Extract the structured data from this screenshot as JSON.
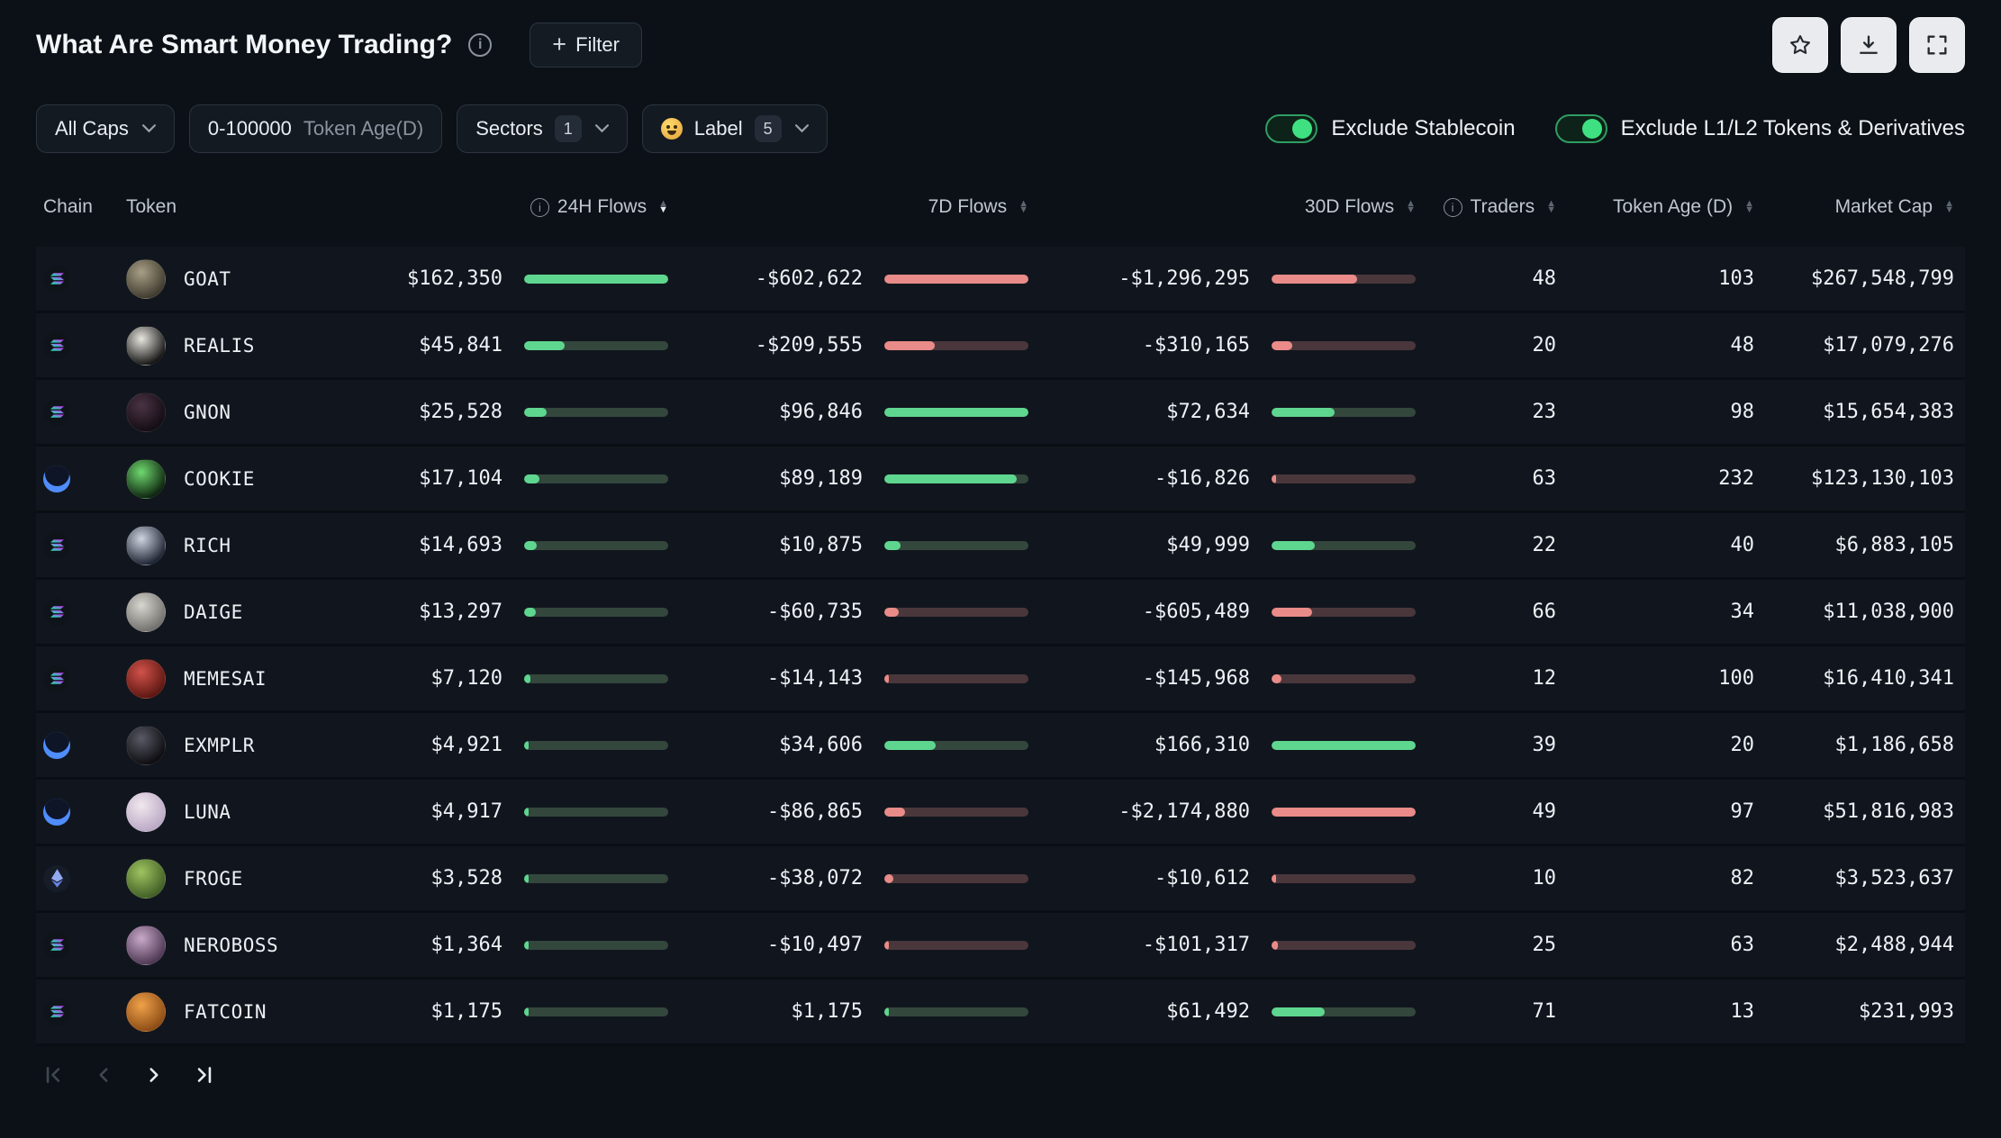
{
  "header": {
    "title": "What Are Smart Money Trading?",
    "filter_button_label": "Filter",
    "actions": [
      {
        "icon": "star"
      },
      {
        "icon": "download"
      },
      {
        "icon": "fullscreen"
      }
    ]
  },
  "filters": {
    "market_cap_dropdown": {
      "label": "All Caps"
    },
    "token_age_filter": {
      "value": "0-100000",
      "label": "Token Age(D)"
    },
    "sectors_dropdown": {
      "label": "Sectors",
      "count": "1"
    },
    "label_dropdown": {
      "label": "Label",
      "count": "5",
      "icon": "smart-money-face"
    },
    "exclude_stablecoin": {
      "label": "Exclude Stablecoin",
      "enabled": true
    },
    "exclude_l1l2": {
      "label": "Exclude L1/L2 Tokens & Derivatives",
      "enabled": true
    }
  },
  "table": {
    "columns": [
      {
        "label": "Chain"
      },
      {
        "label": "Token"
      },
      {
        "label": "24H Flows",
        "info": true,
        "sortable": true
      },
      {
        "label": "7D Flows",
        "sortable": true
      },
      {
        "label": "30D Flows",
        "sortable": true
      },
      {
        "label": "Traders",
        "info": true,
        "sortable": true
      },
      {
        "label": "Token Age (D)",
        "sortable": true
      },
      {
        "label": "Market Cap",
        "sortable": true
      }
    ],
    "sort": {
      "column": "24H Flows",
      "direction": "desc"
    },
    "rows": [
      {
        "chain": "solana",
        "token": "GOAT",
        "avatar_colors": [
          "#a89f86",
          "#3c382c"
        ],
        "flows_24h": {
          "display": "$162,350",
          "value": 162350
        },
        "flows_7d": {
          "display": "-$602,622",
          "value": -602622
        },
        "flows_30d": {
          "display": "-$1,296,295",
          "value": -1296295
        },
        "traders": "48",
        "token_age_d": "103",
        "market_cap": "$267,548,799"
      },
      {
        "chain": "solana",
        "token": "REALIS",
        "avatar_colors": [
          "#e8e6df",
          "#101010"
        ],
        "flows_24h": {
          "display": "$45,841",
          "value": 45841
        },
        "flows_7d": {
          "display": "-$209,555",
          "value": -209555
        },
        "flows_30d": {
          "display": "-$310,165",
          "value": -310165
        },
        "traders": "20",
        "token_age_d": "48",
        "market_cap": "$17,079,276"
      },
      {
        "chain": "solana",
        "token": "GNON",
        "avatar_colors": [
          "#4a3344",
          "#120b12"
        ],
        "flows_24h": {
          "display": "$25,528",
          "value": 25528
        },
        "flows_7d": {
          "display": "$96,846",
          "value": 96846
        },
        "flows_30d": {
          "display": "$72,634",
          "value": 72634
        },
        "traders": "23",
        "token_age_d": "98",
        "market_cap": "$15,654,383"
      },
      {
        "chain": "base",
        "token": "COOKIE",
        "avatar_colors": [
          "#6fd96f",
          "#0b1f0c"
        ],
        "flows_24h": {
          "display": "$17,104",
          "value": 17104
        },
        "flows_7d": {
          "display": "$89,189",
          "value": 89189
        },
        "flows_30d": {
          "display": "-$16,826",
          "value": -16826
        },
        "traders": "63",
        "token_age_d": "232",
        "market_cap": "$123,130,103"
      },
      {
        "chain": "solana",
        "token": "RICH",
        "avatar_colors": [
          "#cfd4e0",
          "#1a1f2e"
        ],
        "flows_24h": {
          "display": "$14,693",
          "value": 14693
        },
        "flows_7d": {
          "display": "$10,875",
          "value": 10875
        },
        "flows_30d": {
          "display": "$49,999",
          "value": 49999
        },
        "traders": "22",
        "token_age_d": "40",
        "market_cap": "$6,883,105"
      },
      {
        "chain": "solana",
        "token": "DAIGE",
        "avatar_colors": [
          "#d8d6d0",
          "#6f6e6a"
        ],
        "flows_24h": {
          "display": "$13,297",
          "value": 13297
        },
        "flows_7d": {
          "display": "-$60,735",
          "value": -60735
        },
        "flows_30d": {
          "display": "-$605,489",
          "value": -605489
        },
        "traders": "66",
        "token_age_d": "34",
        "market_cap": "$11,038,900"
      },
      {
        "chain": "solana",
        "token": "MEMESAI",
        "avatar_colors": [
          "#d0524a",
          "#5a1510"
        ],
        "flows_24h": {
          "display": "$7,120",
          "value": 7120
        },
        "flows_7d": {
          "display": "-$14,143",
          "value": -14143
        },
        "flows_30d": {
          "display": "-$145,968",
          "value": -145968
        },
        "traders": "12",
        "token_age_d": "100",
        "market_cap": "$16,410,341"
      },
      {
        "chain": "base",
        "token": "EXMPLR",
        "avatar_colors": [
          "#5a5a66",
          "#0a0a0e"
        ],
        "flows_24h": {
          "display": "$4,921",
          "value": 4921
        },
        "flows_7d": {
          "display": "$34,606",
          "value": 34606
        },
        "flows_30d": {
          "display": "$166,310",
          "value": 166310
        },
        "traders": "39",
        "token_age_d": "20",
        "market_cap": "$1,186,658"
      },
      {
        "chain": "base",
        "token": "LUNA",
        "avatar_colors": [
          "#f2e8ee",
          "#b9a7c4"
        ],
        "flows_24h": {
          "display": "$4,917",
          "value": 4917
        },
        "flows_7d": {
          "display": "-$86,865",
          "value": -86865
        },
        "flows_30d": {
          "display": "-$2,174,880",
          "value": -2174880
        },
        "traders": "49",
        "token_age_d": "97",
        "market_cap": "$51,816,983"
      },
      {
        "chain": "ethereum",
        "token": "FROGE",
        "avatar_colors": [
          "#9ec45f",
          "#3f5c25"
        ],
        "flows_24h": {
          "display": "$3,528",
          "value": 3528
        },
        "flows_7d": {
          "display": "-$38,072",
          "value": -38072
        },
        "flows_30d": {
          "display": "-$10,612",
          "value": -10612
        },
        "traders": "10",
        "token_age_d": "82",
        "market_cap": "$3,523,637"
      },
      {
        "chain": "solana",
        "token": "NEROBOSS",
        "avatar_colors": [
          "#c9a9c9",
          "#4a3550"
        ],
        "flows_24h": {
          "display": "$1,364",
          "value": 1364
        },
        "flows_7d": {
          "display": "-$10,497",
          "value": -10497
        },
        "flows_30d": {
          "display": "-$101,317",
          "value": -101317
        },
        "traders": "25",
        "token_age_d": "63",
        "market_cap": "$2,488,944"
      },
      {
        "chain": "solana",
        "token": "FATCOIN",
        "avatar_colors": [
          "#f0a24a",
          "#8a4a14"
        ],
        "flows_24h": {
          "display": "$1,175",
          "value": 1175
        },
        "flows_7d": {
          "display": "$1,175",
          "value": 1175
        },
        "flows_30d": {
          "display": "$61,492",
          "value": 61492
        },
        "traders": "71",
        "token_age_d": "13",
        "market_cap": "$231,993"
      }
    ]
  },
  "pagination": {
    "first_enabled": false,
    "prev_enabled": false,
    "next_enabled": true,
    "last_enabled": true
  },
  "colors": {
    "background": "#0c1117",
    "row_background": "#11161e",
    "positive_bar": "#5fd68f",
    "positive_track": "#33473d",
    "negative_bar": "#e98b88",
    "negative_track": "#4a373b",
    "toggle_on": "#3fe081",
    "chain_base_blue": "#4f8dfd"
  }
}
